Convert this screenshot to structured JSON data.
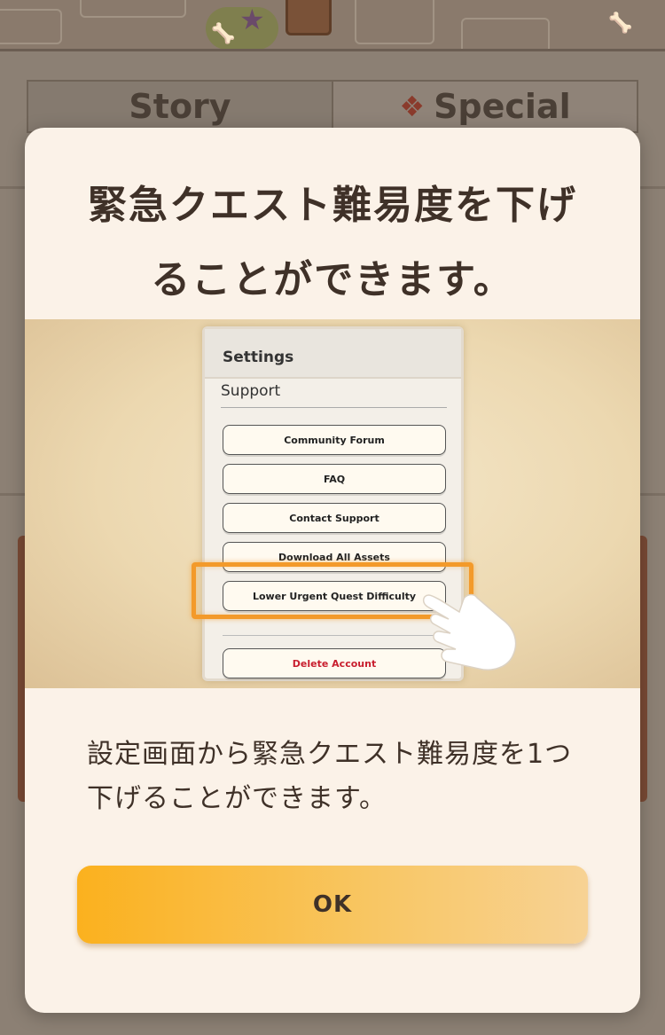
{
  "background": {
    "tabs": [
      {
        "label": "Story",
        "icon": ""
      },
      {
        "label": "Special",
        "icon": "diamond-flower-icon"
      }
    ]
  },
  "modal": {
    "title": "緊急クエスト難易度を下げることができます。",
    "preview": {
      "settings_title": "Settings",
      "section_label": "Support",
      "buttons": [
        "Community Forum",
        "FAQ",
        "Contact Support",
        "Download All Assets",
        "Lower Urgent Quest Difficulty",
        "Delete Account"
      ],
      "highlighted_index": 4,
      "pointer_icon": "pointing-hand-icon",
      "highlight_color": "#f39a2a",
      "danger_color": "#c81e2e"
    },
    "body": "設定画面から緊急クエスト難易度を1つ下げることができます。",
    "ok_label": "OK",
    "accent_color": "#fbb11e"
  }
}
